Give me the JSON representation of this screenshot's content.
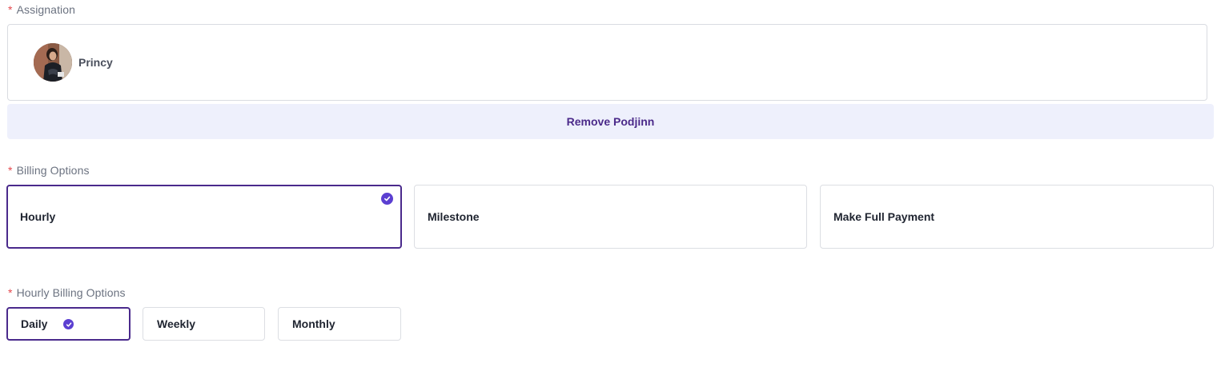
{
  "assignation": {
    "label": "Assignation",
    "required_mark": "*",
    "assignee": {
      "name": "Princy"
    },
    "remove_button": "Remove Podjinn"
  },
  "billing_options": {
    "label": "Billing Options",
    "required_mark": "*",
    "options": [
      {
        "label": "Hourly",
        "selected": true
      },
      {
        "label": "Milestone",
        "selected": false
      },
      {
        "label": "Make Full Payment",
        "selected": false
      }
    ]
  },
  "hourly_billing_options": {
    "label": "Hourly Billing Options",
    "required_mark": "*",
    "options": [
      {
        "label": "Daily",
        "selected": true
      },
      {
        "label": "Weekly",
        "selected": false
      },
      {
        "label": "Monthly",
        "selected": false
      }
    ]
  },
  "colors": {
    "accent": "#4a2a8c",
    "check": "#5b3fd1",
    "required": "#e5484d",
    "remove_bg": "#eef0fc"
  }
}
